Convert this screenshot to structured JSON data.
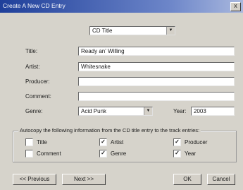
{
  "window": {
    "title": "Create A New CD Entry",
    "close_label": "X"
  },
  "mode_select": {
    "value": "CD Title"
  },
  "fields": {
    "title": {
      "label": "Title:",
      "value": "Ready an' Willing"
    },
    "artist": {
      "label": "Artist:",
      "value": "Whitesnake"
    },
    "producer": {
      "label": "Producer:",
      "value": ""
    },
    "comment": {
      "label": "Comment:",
      "value": ""
    },
    "genre": {
      "label": "Genre:",
      "value": "Acid Punk"
    },
    "year": {
      "label": "Year:",
      "value": "2003"
    }
  },
  "autocopy": {
    "caption": "Autocopy the following information from the CD title entry to the track entries:",
    "options": {
      "title": {
        "label": "Title",
        "checked": false
      },
      "comment": {
        "label": "Comment",
        "checked": false
      },
      "artist": {
        "label": "Artist",
        "checked": true
      },
      "genre": {
        "label": "Genre",
        "checked": true
      },
      "producer": {
        "label": "Producer",
        "checked": true
      },
      "year": {
        "label": "Year",
        "checked": true
      }
    }
  },
  "buttons": {
    "previous": "<< Previous",
    "next": "Next >>",
    "ok": "OK",
    "cancel": "Cancel"
  }
}
